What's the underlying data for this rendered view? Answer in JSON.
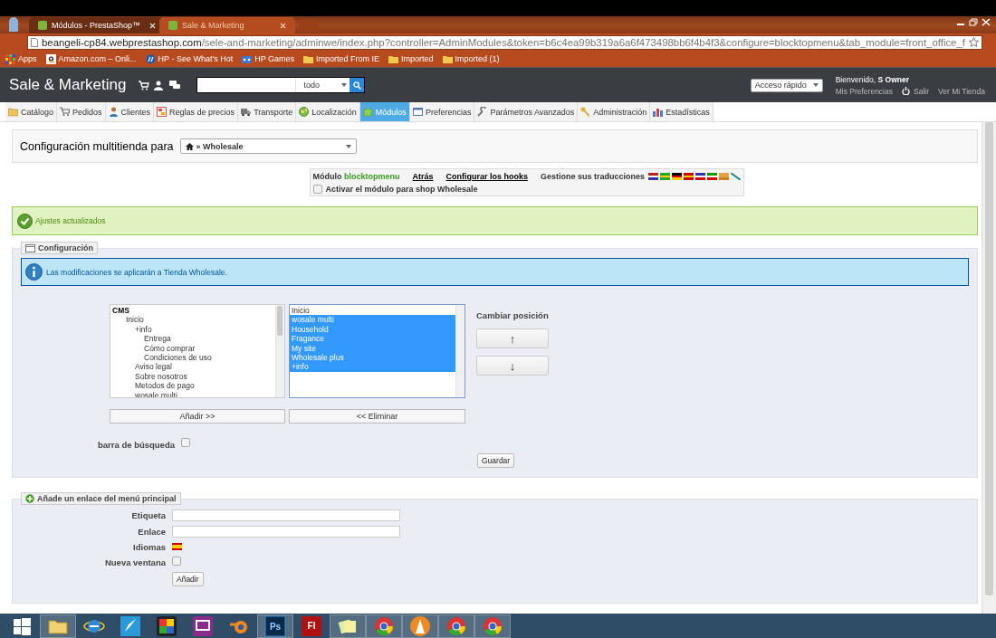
{
  "browser": {
    "tabs": [
      {
        "title": "Módulos - PrestaShop™",
        "selected": true
      },
      {
        "title": "Sale & Marketing",
        "selected": false
      }
    ],
    "url_host": "beangeli-cp84.webprestashop.com",
    "url_path": "/sele-and-marketing/adminwe/index.php?controller=AdminModules&token=b6c4ea99b319a6a6f473498bb6f4b4f3&configure=blocktopmenu&tab_module=front_office_f",
    "bookmarks": [
      {
        "label": "Apps",
        "kind": "apps"
      },
      {
        "label": "Amazon.com – Onli...",
        "kind": "amazon"
      },
      {
        "label": "HP - See What's Hot",
        "kind": "hp"
      },
      {
        "label": "HP Games",
        "kind": "games"
      },
      {
        "label": "Imported From IE",
        "kind": "folder"
      },
      {
        "label": "Imported",
        "kind": "folder"
      },
      {
        "label": "Imported (1)",
        "kind": "folder"
      }
    ]
  },
  "header": {
    "title": "Sale & Marketing",
    "search": {
      "scope": "todo"
    },
    "quick_access": "Acceso rápido",
    "welcome": "Bienvenido, **S Owner**",
    "links": [
      "Mis Preferencias",
      "Salir",
      "Ver Mi Tienda"
    ]
  },
  "nav": {
    "items": [
      {
        "label": "Catálogo",
        "kind": "folder",
        "selected": false
      },
      {
        "label": "Pedidos",
        "kind": "cart",
        "selected": false
      },
      {
        "label": "Clientes",
        "kind": "user",
        "selected": false
      },
      {
        "label": "Reglas de precios",
        "kind": "rules",
        "selected": false
      },
      {
        "label": "Transporte",
        "kind": "truck",
        "selected": false
      },
      {
        "label": "Localización",
        "kind": "globe",
        "selected": false
      },
      {
        "label": "Módulos",
        "kind": "puzzle",
        "selected": true
      },
      {
        "label": "Preferencias",
        "kind": "window",
        "selected": false
      },
      {
        "label": "Parámetros Avanzados",
        "kind": "wrench",
        "selected": false
      },
      {
        "label": "Administración",
        "kind": "key",
        "selected": false
      },
      {
        "label": "Estadísticas",
        "kind": "chart",
        "selected": false
      }
    ]
  },
  "multistore": {
    "label": "Configuración multitienda para",
    "shop": "» Wholesale"
  },
  "module_bar": {
    "module_label": "Módulo",
    "module_name": "blocktopmenu",
    "links": [
      "Atrás",
      "Configurar los hooks"
    ],
    "translations": "Gestione sus traducciones",
    "activate": {
      "label": "Activar el módulo para shop Wholesale",
      "checked": false
    }
  },
  "success": "Ajustes actualizados",
  "config": {
    "legend": "Configuración",
    "info": "Las modificaciones se aplicarán a Tienda Wholesale.",
    "available": [
      {
        "label": "CMS",
        "children": [
          {
            "label": "Inicio",
            "children": [
              {
                "label": "+info",
                "children": [
                  {
                    "label": "Entrega"
                  },
                  {
                    "label": "Cómo comprar"
                  },
                  {
                    "label": "Condiciones de uso"
                  }
                ]
              },
              {
                "label": "Aviso legal"
              },
              {
                "label": "Sobre nosotros"
              },
              {
                "label": "Metodos de pago"
              },
              {
                "label": "wosale multi"
              }
            ]
          }
        ]
      }
    ],
    "selected_items": [
      {
        "label": "Inicio",
        "selected": false
      },
      {
        "label": "wosale multi",
        "selected": true
      },
      {
        "label": "Household",
        "selected": true
      },
      {
        "label": "Fragance",
        "selected": true
      },
      {
        "label": "My site",
        "selected": true
      },
      {
        "label": "Wholesale plus",
        "selected": true
      },
      {
        "label": "+info",
        "selected": true
      }
    ],
    "add_button": "Añadir >>",
    "remove_button": "<< Eliminar",
    "position_label": "Cambiar posición",
    "up": "↑",
    "down": "↓",
    "search_bar": {
      "label": "barra de búsqueda",
      "checked": false
    },
    "save": "Guardar"
  },
  "add_link": {
    "legend": "Añade un enlace del menú principal",
    "label_field": {
      "label": "Etiqueta"
    },
    "link_field": {
      "label": "Enlace"
    },
    "languages_label": "Idiomas",
    "new_window": {
      "label": "Nueva ventana",
      "checked": false
    },
    "submit": "Añadir"
  },
  "taskbar": [
    {
      "kind": "start",
      "running": false
    },
    {
      "kind": "explorer",
      "running": true
    },
    {
      "kind": "ie",
      "running": false
    },
    {
      "kind": "rocket",
      "running": false
    },
    {
      "kind": "tiles",
      "running": false
    },
    {
      "kind": "presenter",
      "running": false
    },
    {
      "kind": "blender",
      "running": false
    },
    {
      "kind": "ps",
      "label": "Ps",
      "running": true
    },
    {
      "kind": "flash",
      "label": "Fl",
      "running": false
    },
    {
      "kind": "notes",
      "running": true
    },
    {
      "kind": "chrome",
      "running": true
    },
    {
      "kind": "vlc",
      "running": true
    },
    {
      "kind": "chrome",
      "running": true
    },
    {
      "kind": "chrome",
      "running": true
    }
  ]
}
